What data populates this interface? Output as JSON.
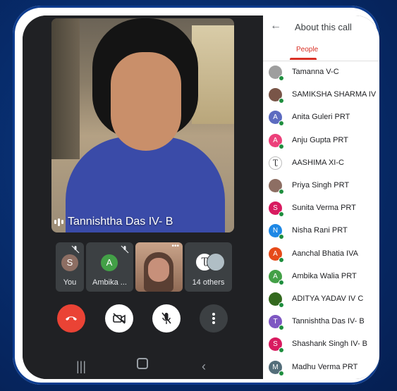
{
  "call": {
    "speaker_name": "Tannishtha Das IV- B",
    "tiles": [
      {
        "label": "You",
        "initial": "S",
        "color": "#8d6e63"
      },
      {
        "label": "Ambika ...",
        "initial": "A",
        "color": "#43a047"
      },
      {
        "label": "",
        "initial": "",
        "color": ""
      },
      {
        "label": "14 others",
        "initial": "",
        "color": ""
      }
    ],
    "more_dots": "•••"
  },
  "panel": {
    "back_glyph": "←",
    "title": "About this call",
    "tab": "People",
    "people": [
      {
        "name": "Tamanna V-C",
        "initial": "",
        "color": "#9e9e9e",
        "photo": true
      },
      {
        "name": "SAMIKSHA SHARMA IV",
        "initial": "",
        "color": "#795548",
        "photo": true
      },
      {
        "name": "Anita Guleri PRT",
        "initial": "A",
        "color": "#5c6bc0"
      },
      {
        "name": "Anju Gupta PRT",
        "initial": "A",
        "color": "#ec407a"
      },
      {
        "name": "AASHIMA XI-C",
        "initial": "Ʈ",
        "color": "#ffffff",
        "photo": true
      },
      {
        "name": "Priya Singh PRT",
        "initial": "",
        "color": "#8d6e63",
        "photo": true
      },
      {
        "name": "Sunita Verma PRT",
        "initial": "S",
        "color": "#d81b60"
      },
      {
        "name": "Nisha Rani PRT",
        "initial": "N",
        "color": "#1e88e5"
      },
      {
        "name": "Aanchal Bhatia IVA",
        "initial": "A",
        "color": "#e64a19"
      },
      {
        "name": "Ambika Walia PRT",
        "initial": "A",
        "color": "#43a047"
      },
      {
        "name": "ADITYA YADAV IV C",
        "initial": "",
        "color": "#33691e",
        "photo": true
      },
      {
        "name": "Tannishtha Das IV- B",
        "initial": "T",
        "color": "#7e57c2"
      },
      {
        "name": "Shashank Singh IV- B",
        "initial": "S",
        "color": "#d81b60"
      },
      {
        "name": "Madhu Verma PRT",
        "initial": "M",
        "color": "#546e7a"
      }
    ]
  },
  "colors": {
    "end_call": "#ea4335",
    "accent": "#d93025"
  }
}
